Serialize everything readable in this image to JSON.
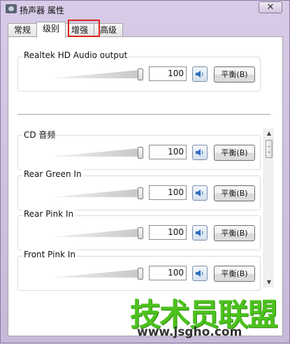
{
  "window": {
    "title": "扬声器 属性",
    "close_glyph": "✕"
  },
  "tabs": [
    {
      "label": "常规",
      "active": false
    },
    {
      "label": "级别",
      "active": true
    },
    {
      "label": "增强",
      "active": false,
      "highlighted": true
    },
    {
      "label": "高级",
      "active": false
    }
  ],
  "main_output": {
    "label": "Realtek HD Audio output",
    "value": "100",
    "level_percent": 100,
    "balance_label": "平衡(B)"
  },
  "channels": [
    {
      "label": "CD 音频",
      "value": "100",
      "level_percent": 100,
      "balance_label": "平衡(B)"
    },
    {
      "label": "Rear Green In",
      "value": "100",
      "level_percent": 100,
      "balance_label": "平衡(B)"
    },
    {
      "label": "Rear Pink In",
      "value": "100",
      "level_percent": 100,
      "balance_label": "平衡(B)"
    },
    {
      "label": "Front Pink In",
      "value": "100",
      "level_percent": 100,
      "balance_label": "平衡(B)"
    }
  ],
  "scrollbar": {
    "up_glyph": "▲",
    "down_glyph": "▼"
  },
  "watermark": {
    "brand": "技术员联盟",
    "url": "www.jsgho.com"
  },
  "colors": {
    "highlight_border": "#e0221d",
    "watermark_green": "#4cc21d",
    "speaker_blue": "#2f6fc0"
  }
}
